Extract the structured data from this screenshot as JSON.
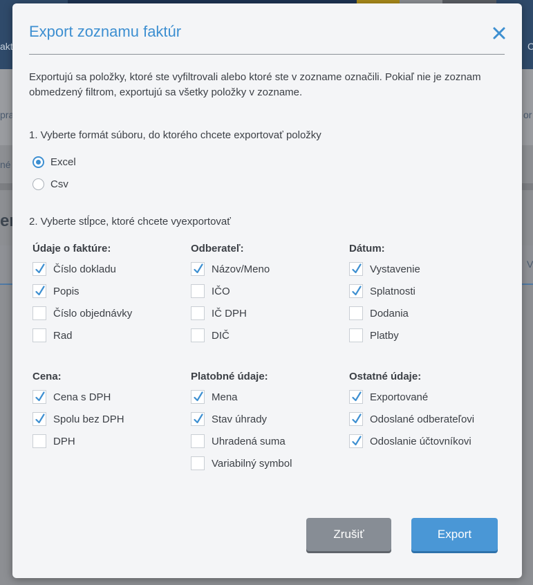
{
  "dialog": {
    "title": "Export zoznamu faktúr",
    "intro": "Exportujú sa položky, ktoré ste vyfiltrovali alebo ktoré ste v zozname označili. Pokiaľ nie je zoznam obmedzený filtrom, exportujú sa všetky položky v zozname.",
    "step1": "1. Vyberte formát súboru, do ktorého chcete exportovať položky",
    "formats": [
      {
        "label": "Excel",
        "selected": true
      },
      {
        "label": "Csv",
        "selected": false
      }
    ],
    "step2": "2. Vyberte stĺpce, ktoré chcete vyexportovať",
    "groups": [
      {
        "title": "Údaje o faktúre:",
        "items": [
          {
            "label": "Číslo dokladu",
            "checked": true
          },
          {
            "label": "Popis",
            "checked": true
          },
          {
            "label": "Číslo objednávky",
            "checked": false
          },
          {
            "label": "Rad",
            "checked": false
          }
        ]
      },
      {
        "title": "Odberateľ:",
        "items": [
          {
            "label": "Názov/Meno",
            "checked": true
          },
          {
            "label": "IČO",
            "checked": false
          },
          {
            "label": "IČ DPH",
            "checked": false
          },
          {
            "label": "DIČ",
            "checked": false
          }
        ]
      },
      {
        "title": "Dátum:",
        "items": [
          {
            "label": "Vystavenie",
            "checked": true
          },
          {
            "label": "Splatnosti",
            "checked": true
          },
          {
            "label": "Dodania",
            "checked": false
          },
          {
            "label": "Platby",
            "checked": false
          }
        ]
      },
      {
        "title": "Cena:",
        "items": [
          {
            "label": "Cena s DPH",
            "checked": true
          },
          {
            "label": "Spolu bez DPH",
            "checked": true
          },
          {
            "label": "DPH",
            "checked": false
          }
        ]
      },
      {
        "title": "Platobné údaje:",
        "items": [
          {
            "label": "Mena",
            "checked": true
          },
          {
            "label": "Stav úhrady",
            "checked": true
          },
          {
            "label": "Uhradená suma",
            "checked": false
          },
          {
            "label": "Variabilný symbol",
            "checked": false
          }
        ]
      },
      {
        "title": "Ostatné údaje:",
        "items": [
          {
            "label": "Exportované",
            "checked": true
          },
          {
            "label": "Odoslané odberateľovi",
            "checked": true
          },
          {
            "label": "Odoslanie účtovníkovi",
            "checked": true
          }
        ]
      }
    ],
    "cancel_label": "Zrušiť",
    "export_label": "Export",
    "close_icon": "close-icon"
  },
  "background": {
    "left_fragments": [
      "akt",
      "pra",
      "né",
      "en"
    ],
    "right_fragments": [
      "C",
      "or",
      "V"
    ]
  },
  "colors": {
    "accent": "#3d8fd1",
    "cancel": "#878d95",
    "export": "#4a97d6"
  }
}
